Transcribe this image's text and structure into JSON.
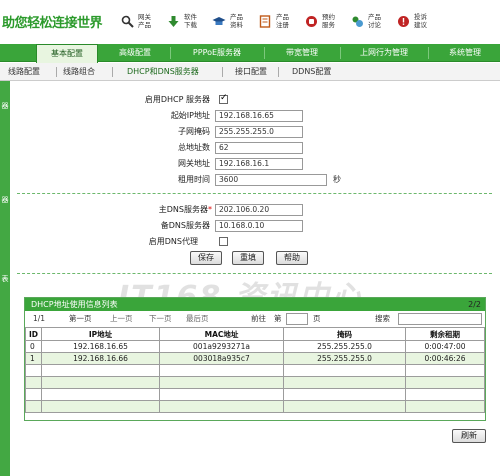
{
  "brand": "助您轻松连接世界",
  "top_links": [
    {
      "icon": "search-icon",
      "l1": "网关",
      "l2": "产品"
    },
    {
      "icon": "download-icon",
      "l1": "软件",
      "l2": "下载"
    },
    {
      "icon": "graduation-cap-icon",
      "l1": "产品",
      "l2": "资料"
    },
    {
      "icon": "register-icon",
      "l1": "产品",
      "l2": "注册"
    },
    {
      "icon": "phone-service-icon",
      "l1": "预约",
      "l2": "服务"
    },
    {
      "icon": "discuss-icon",
      "l1": "产品",
      "l2": "讨论"
    },
    {
      "icon": "feedback-icon",
      "l1": "投诉",
      "l2": "建议"
    }
  ],
  "main_nav": [
    "基本配置",
    "高级配置",
    "PPPoE服务器",
    "带宽管理",
    "上网行为管理",
    "系统管理"
  ],
  "sub_nav": [
    "线路配置",
    "线路组合",
    "DHCP和DNS服务器",
    "接口配置",
    "DDNS配置"
  ],
  "left_marks": [
    "器",
    "器",
    "表"
  ],
  "dhcp": {
    "enable_label": "启用DHCP 服务器",
    "enabled": true,
    "start_ip_label": "起始IP地址",
    "start_ip": "192.168.16.65",
    "mask_label": "子网掩码",
    "mask": "255.255.255.0",
    "total_label": "总地址数",
    "total": "62",
    "gateway_label": "网关地址",
    "gateway": "192.168.16.1",
    "lease_label": "租用时间",
    "lease": "3600",
    "lease_unit": "秒"
  },
  "dns": {
    "primary_label": "主DNS服务器",
    "primary_req": "*",
    "primary": "202.106.0.20",
    "secondary_label": "备DNS服务器",
    "secondary": "10.168.0.10",
    "proxy_label": "启用DNS代理",
    "proxy_enabled": false
  },
  "buttons": {
    "save": "保存",
    "reset": "重填",
    "help": "帮助",
    "refresh": "刷新"
  },
  "watermark": "IT168 资讯中心",
  "table": {
    "title": "DHCP地址使用信息列表",
    "page_count": "2/2",
    "pager": {
      "current": "1/1",
      "first": "第一页",
      "prev": "上一页",
      "next": "下一页",
      "last": "最后页",
      "goto": "前往",
      "di": "第",
      "ye": "页",
      "search": "搜索"
    },
    "columns": [
      "ID",
      "IP地址",
      "MAC地址",
      "掩码",
      "剩余租期"
    ],
    "rows": [
      [
        "0",
        "192.168.16.65",
        "001a9293271a",
        "255.255.255.0",
        "0:00:47:00"
      ],
      [
        "1",
        "192.168.16.66",
        "003018a935c7",
        "255.255.255.0",
        "0:00:46:26"
      ],
      [
        "",
        "",
        "",
        "",
        ""
      ],
      [
        "",
        "",
        "",
        "",
        ""
      ],
      [
        "",
        "",
        "",
        "",
        ""
      ],
      [
        "",
        "",
        "",
        "",
        ""
      ]
    ]
  }
}
